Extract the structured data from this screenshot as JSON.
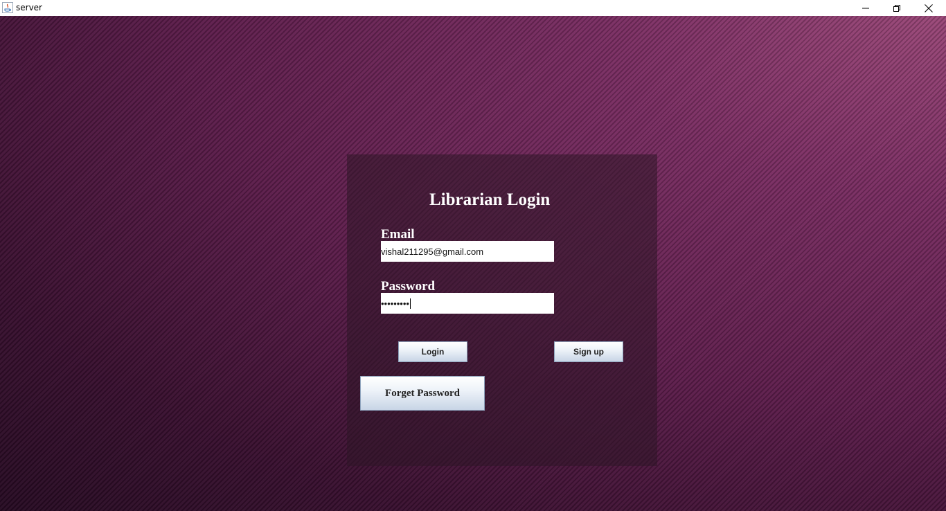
{
  "window": {
    "title": "server",
    "controls": {
      "minimize_icon": "minimize-icon",
      "maximize_icon": "restore-icon",
      "close_icon": "close-icon"
    }
  },
  "login_form": {
    "heading": "Librarian Login",
    "email_label": "Email",
    "email_value": "vishal211295@gmail.com",
    "password_label": "Password",
    "password_masked": "•••••••••",
    "login_button": "Login",
    "signup_button": "Sign up",
    "forget_button": "Forget Password"
  },
  "colors": {
    "background_dark": "#260a22",
    "background_light": "#9a4778",
    "panel": "#2d1626",
    "heading_text": "#ffffff"
  }
}
